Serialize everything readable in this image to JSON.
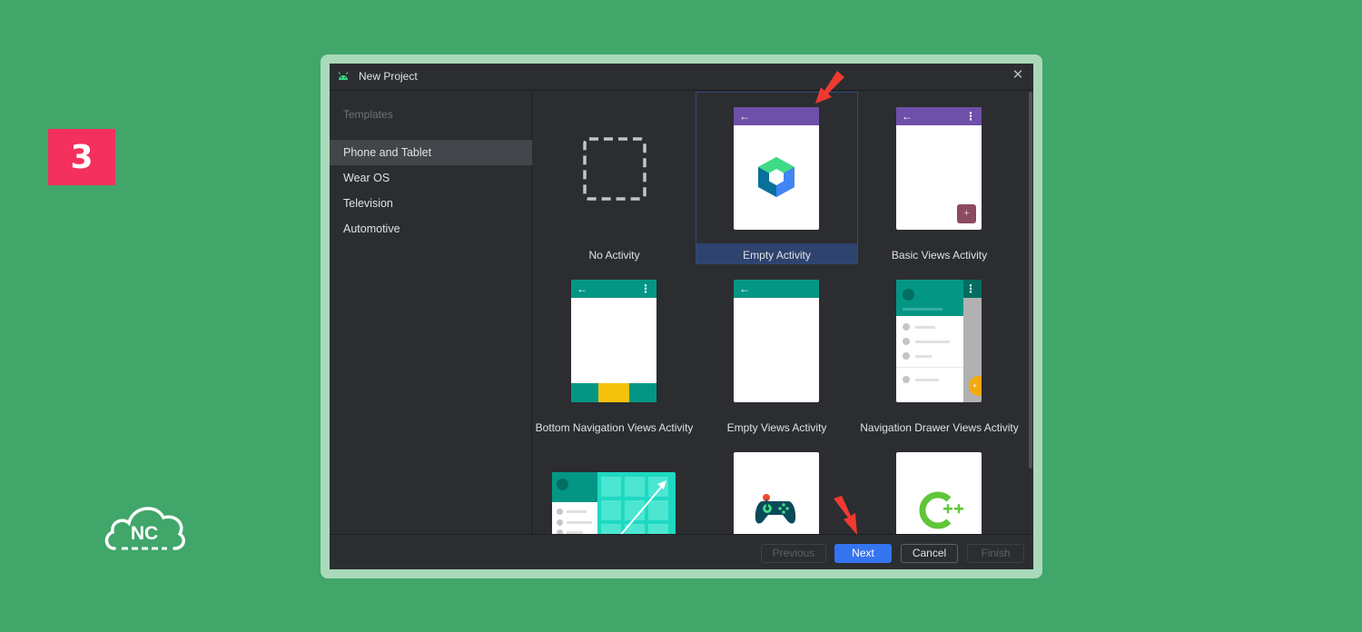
{
  "step_badge": "3",
  "logo_text": "NC",
  "window": {
    "title": "New Project",
    "close_glyph": "✕"
  },
  "sidebar": {
    "heading": "Templates",
    "items": [
      {
        "label": "Phone and Tablet",
        "active": true
      },
      {
        "label": "Wear OS"
      },
      {
        "label": "Television"
      },
      {
        "label": "Automotive"
      }
    ]
  },
  "templates": [
    {
      "label": "No Activity"
    },
    {
      "label": "Empty Activity",
      "selected": true
    },
    {
      "label": "Basic Views Activity"
    },
    {
      "label": "Bottom Navigation Views Activity"
    },
    {
      "label": "Empty Views Activity"
    },
    {
      "label": "Navigation Drawer Views Activity"
    }
  ],
  "footer": {
    "previous": "Previous",
    "next": "Next",
    "cancel": "Cancel",
    "finish": "Finish"
  },
  "colors": {
    "background": "#41a66a",
    "badge": "#f4305e",
    "purple_appbar": "#6e4fa9",
    "teal_appbar": "#039685",
    "primary_button": "#3574f0",
    "annotation_arrow": "#f03a30"
  }
}
